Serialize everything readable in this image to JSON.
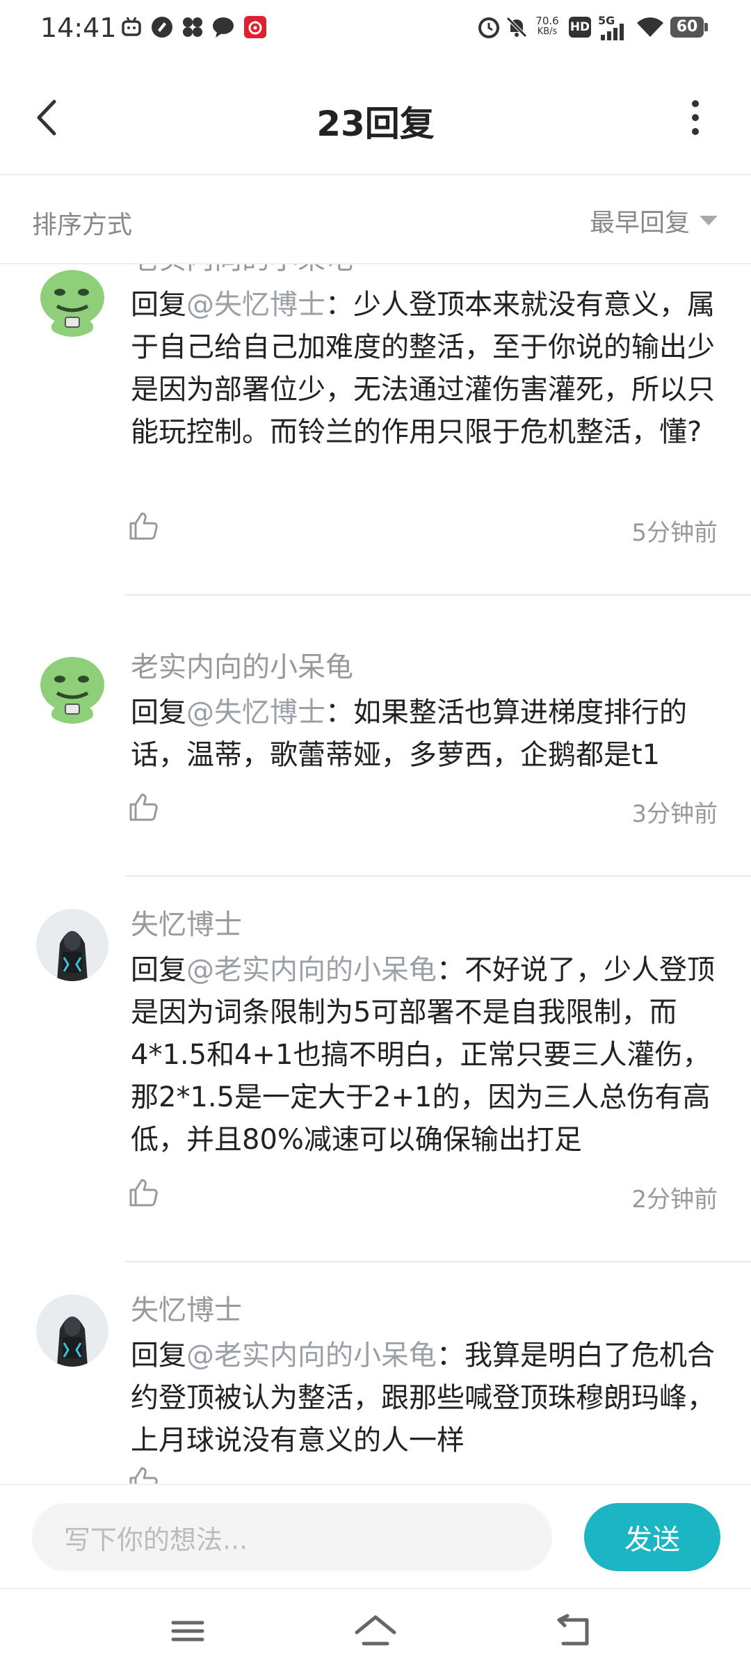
{
  "status_bar": {
    "time": "14:41",
    "net_speed_value": "70.6",
    "net_speed_unit": "KB/s",
    "hd_badge": "HD",
    "network": "5G",
    "battery": "60",
    "icons": [
      "bilibili-icon",
      "app-icon",
      "app-grid-icon",
      "chat-icon",
      "netease-music-icon",
      "alarm-icon",
      "mute-icon",
      "signal-icon",
      "wifi-icon",
      "battery-icon"
    ]
  },
  "header": {
    "title": "23回复",
    "back_icon": "back-arrow-icon",
    "more_icon": "more-vertical-icon"
  },
  "sort": {
    "label": "排序方式",
    "value": "最早回复",
    "caret_icon": "caret-down-icon"
  },
  "comments": [
    {
      "author": "老实内向的小呆龟",
      "avatar": "green-meme-face-avatar",
      "prefix": "回复",
      "mention": "@失忆博士",
      "text": "：少人登顶本来就没有意义，属于自己给自己加难度的整活，至于你说的输出少是因为部署位少，无法通过灌伤害灌死，所以只能玩控制。而铃兰的作用只限于危机整活，懂?",
      "time": "5分钟前"
    },
    {
      "author": "老实内向的小呆龟",
      "avatar": "green-meme-face-avatar",
      "prefix": "回复",
      "mention": "@失忆博士",
      "text": "：如果整活也算进梯度排行的话，温蒂，歌蕾蒂娅，多萝西，企鹅都是t1",
      "time": "3分钟前"
    },
    {
      "author": "失忆博士",
      "avatar": "hooded-figure-avatar",
      "prefix": "回复",
      "mention": "@老实内向的小呆龟",
      "text": "：不好说了，少人登顶是因为词条限制为5可部署不是自我限制，而4*1.5和4+1也搞不明白，正常只要三人灌伤，那2*1.5是一定大于2+1的，因为三人总伤有高低，并且80%减速可以确保输出打足",
      "time": "2分钟前"
    },
    {
      "author": "失忆博士",
      "avatar": "hooded-figure-avatar",
      "prefix": "回复",
      "mention": "@老实内向的小呆龟",
      "text": "：我算是明白了危机合约登顶被认为整活，跟那些喊登顶珠穆朗玛峰，上月球说没有意义的人一样",
      "time": ""
    }
  ],
  "input": {
    "placeholder": "写下你的想法...",
    "send_label": "发送",
    "accent_color": "#1cb5c4"
  },
  "nav_bar": {
    "icons": [
      "menu-icon",
      "home-icon",
      "back-icon"
    ]
  }
}
